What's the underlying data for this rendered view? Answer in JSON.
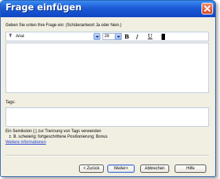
{
  "window": {
    "title": "Frage einfügen"
  },
  "question": {
    "prompt": "Geben Sie unten Ihre Frage ein: (Schülerantwort Ja oder Nein.)"
  },
  "toolbar": {
    "font_icon_glyph": "Ŧ",
    "font_name": "Arial",
    "font_size": "28",
    "bold_label": "B",
    "italic_label": "/",
    "underline_label": "U"
  },
  "tags": {
    "label": "Tags:",
    "hint": "Ein Semikolon (;) zur Trennung von Tags verwenden",
    "example": "z. B. schwierig; fortgeschrittene Positionierung; Bonus",
    "more_link": "Weitere Informationen"
  },
  "buttons": {
    "back": "< Zurück",
    "next": "Weiter>",
    "cancel": "Abbrechen",
    "help": "Hilfe"
  },
  "colors": {
    "titlebar": "#1c5ad6",
    "dialog_bg": "#f1efe2",
    "close_button": "#d64a22",
    "link": "#1a3ad0"
  }
}
